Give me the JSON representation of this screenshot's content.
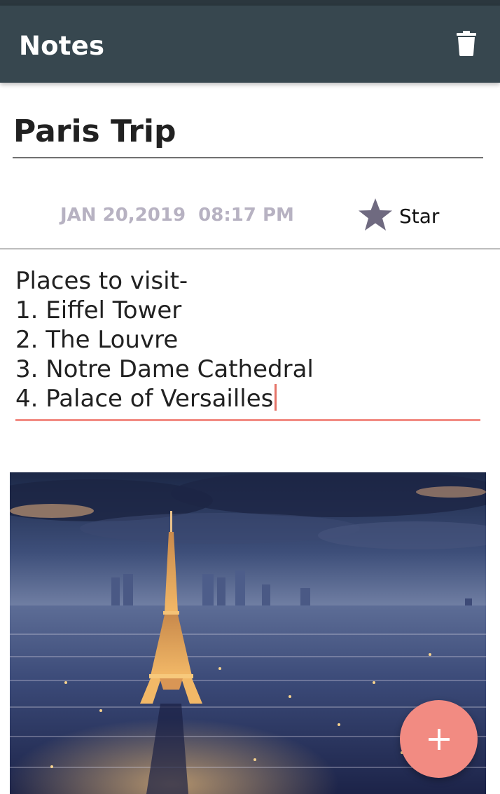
{
  "appbar": {
    "title": "Notes",
    "delete_icon": "trash-icon"
  },
  "note": {
    "title": "Paris Trip",
    "date": "JAN 20,2019  08:17 PM",
    "star_label": "Star",
    "star_icon": "star-icon",
    "body_lines": [
      "Places to visit-",
      "1. Eiffel Tower",
      "2. The Louvre",
      "3. Notre Dame Cathedral",
      "4. Palace of Versailles"
    ],
    "attachment": "eiffel-tower-paris-photo"
  },
  "fab": {
    "icon": "plus-icon"
  },
  "colors": {
    "appbar": "#37474f",
    "accent": "#f28b82",
    "star": "#6f6a80",
    "date": "#b7b2c2"
  }
}
